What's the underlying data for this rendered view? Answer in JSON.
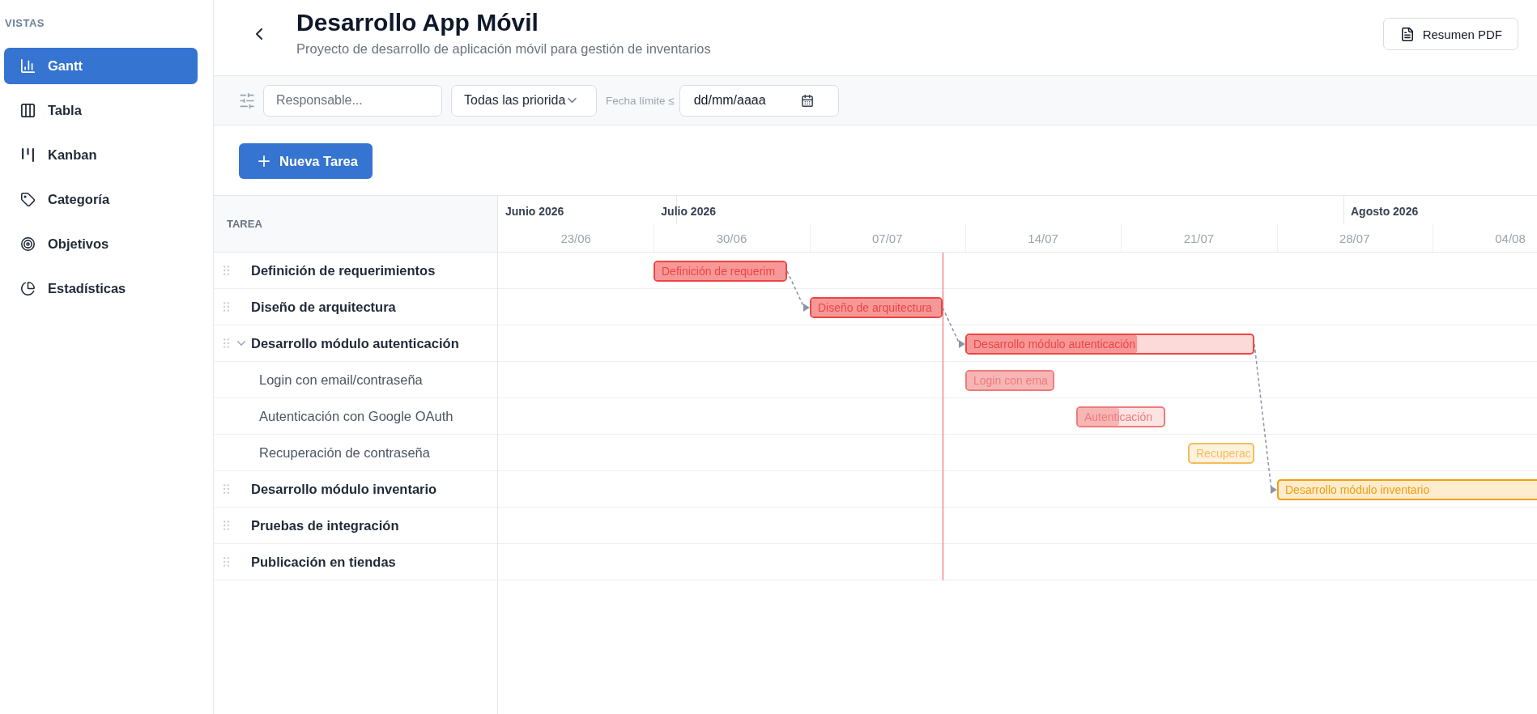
{
  "sidebar": {
    "heading": "VISTAS",
    "items": [
      {
        "label": "Gantt",
        "selected": true
      },
      {
        "label": "Tabla",
        "selected": false
      },
      {
        "label": "Kanban",
        "selected": false
      },
      {
        "label": "Categoría",
        "selected": false
      },
      {
        "label": "Objetivos",
        "selected": false
      },
      {
        "label": "Estadísticas",
        "selected": false
      }
    ]
  },
  "header": {
    "title": "Desarrollo App Móvil",
    "subtitle": "Proyecto de desarrollo de aplicación móvil para gestión de inventarios",
    "pdf_button": "Resumen PDF"
  },
  "filters": {
    "assignee": {
      "placeholder": "Responsable..."
    },
    "priority": {
      "value": "Todas las priorida"
    },
    "due_label": "Fecha límite ≤",
    "due_date": {
      "placeholder": "dd/mm/aaaa"
    }
  },
  "new_task_button": "Nueva Tarea",
  "gantt": {
    "column_header": "TAREA",
    "months": [
      "Junio 2026",
      "Julio 2026",
      "Agosto 2026"
    ],
    "weeks": [
      "23/06",
      "30/06",
      "07/07",
      "14/07",
      "21/07",
      "28/07",
      "04/08"
    ],
    "tasks": [
      {
        "name": "Definición de requerimientos",
        "bar_label": "Definición de requerim",
        "level": 1,
        "color": "#ef4444"
      },
      {
        "name": "Diseño de arquitectura",
        "bar_label": "Diseño de arquitectura",
        "level": 1,
        "color": "#ef4444"
      },
      {
        "name": "Desarrollo módulo autenticación",
        "bar_label": "Desarrollo módulo autenticación",
        "level": 0.6,
        "color": "#ef4444",
        "expanded": true,
        "children": [
          {
            "name": "Login con email/contraseña",
            "bar_label": "Login con ema",
            "level": 1,
            "color": "#f17a7a"
          },
          {
            "name": "Autenticación con Google OAuth",
            "bar_label": "Autenticación",
            "level": 0.5,
            "color": "#f17a7a"
          },
          {
            "name": "Recuperación de contraseña",
            "bar_label": "Recuperac",
            "color": "#f6bd5c"
          }
        ]
      },
      {
        "name": "Desarrollo módulo inventario",
        "bar_label": "Desarrollo módulo inventario",
        "color": "#f59e0b"
      },
      {
        "name": "Pruebas de integración"
      },
      {
        "name": "Publicación en tiendas"
      }
    ]
  }
}
